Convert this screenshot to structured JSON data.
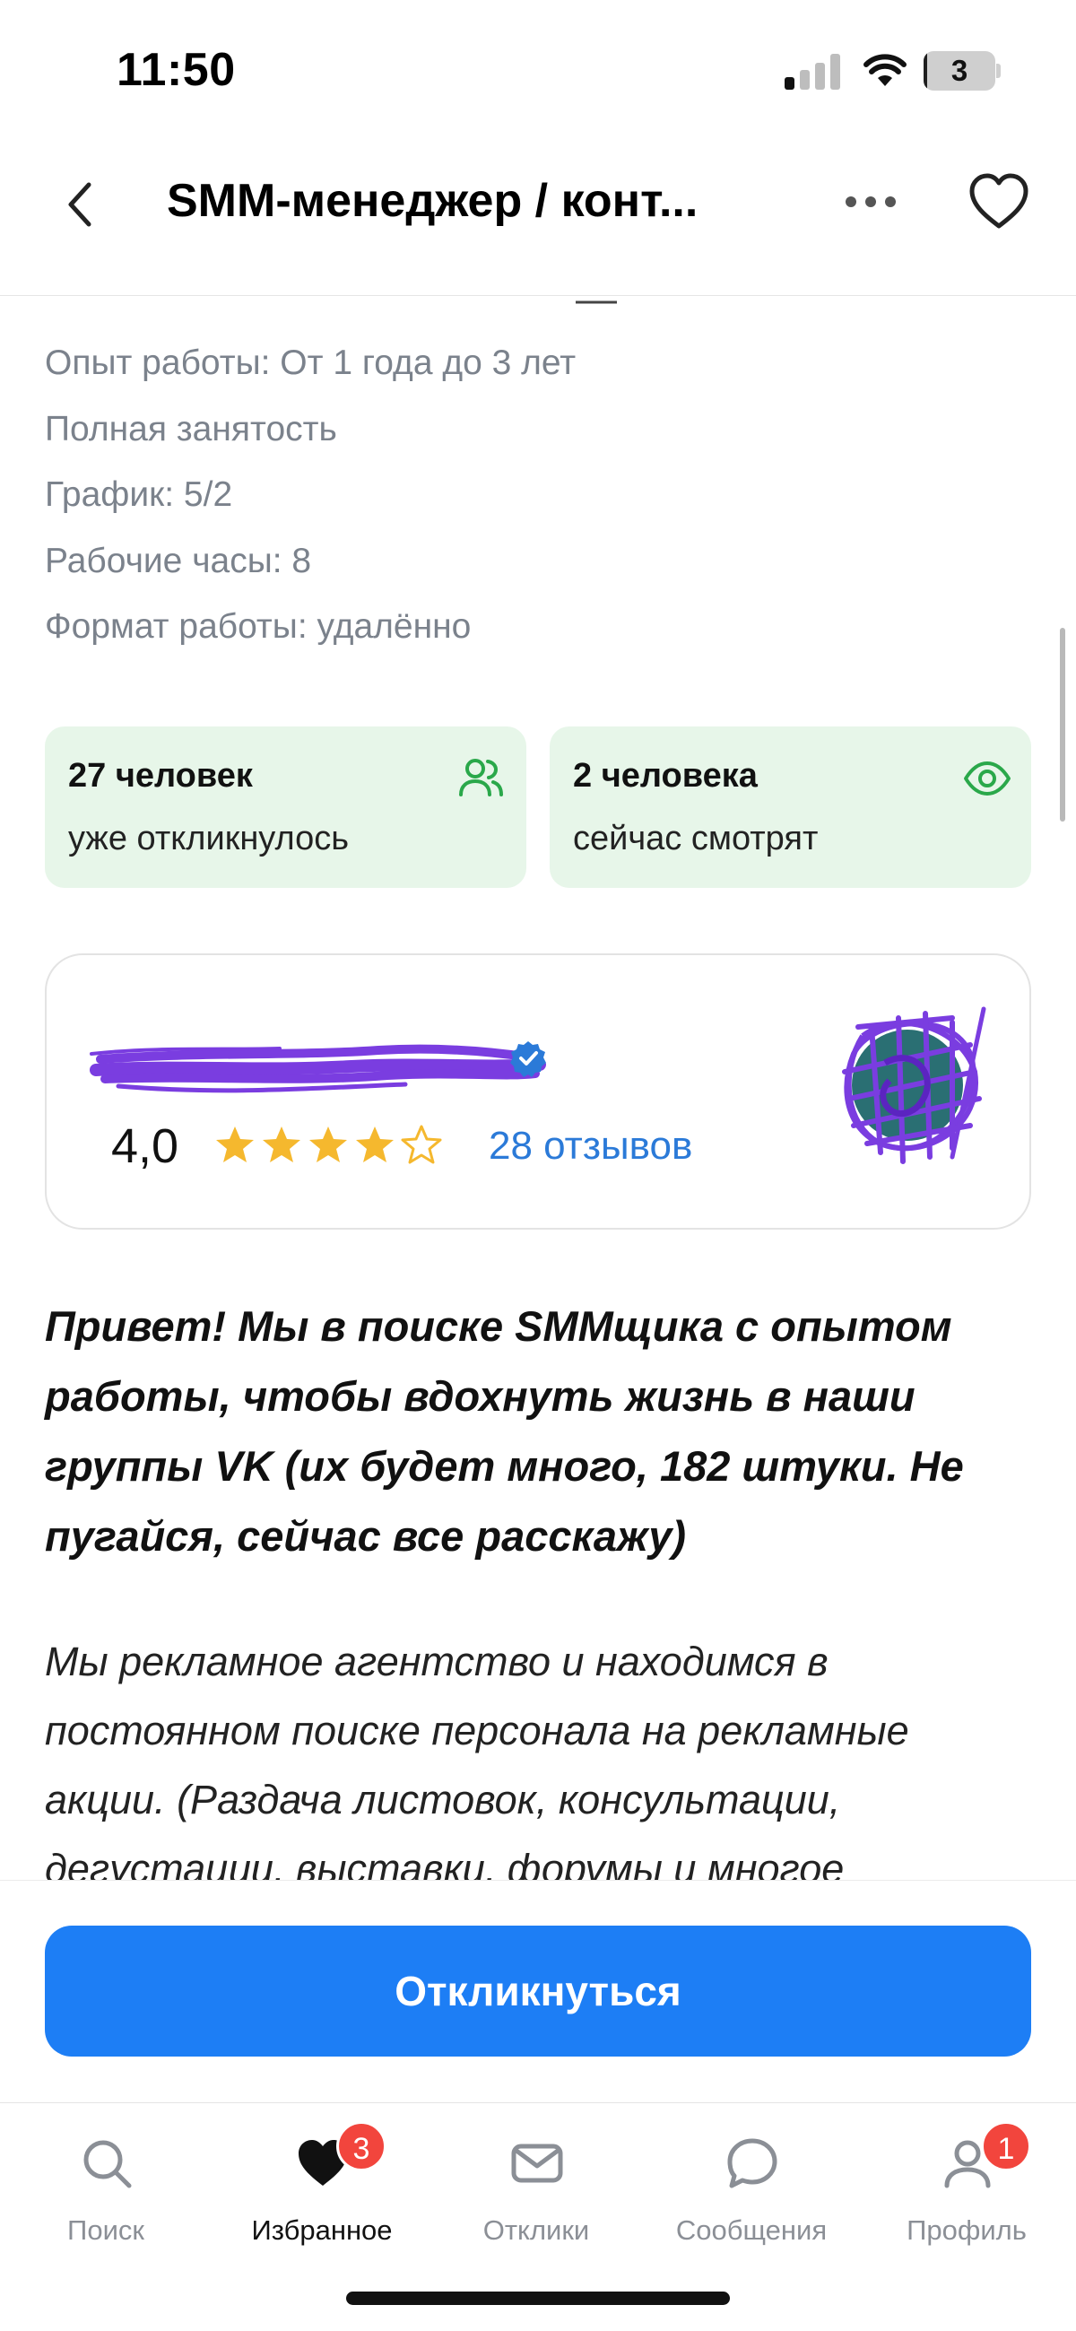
{
  "status_bar": {
    "time": "11:50",
    "battery_level": "3",
    "battery_percent": 3
  },
  "nav": {
    "title": "SMM-менеджер / конт..."
  },
  "details": [
    "Опыт работы: От 1 года до 3 лет",
    "Полная занятость",
    "График: 5/2",
    "Рабочие часы: 8",
    "Формат работы: удалённо"
  ],
  "stats": [
    {
      "title": "27 человек",
      "subtitle": "уже откликнулось",
      "icon": "users-icon"
    },
    {
      "title": "2 человека",
      "subtitle": "сейчас смотрят",
      "icon": "eye-icon"
    }
  ],
  "employer": {
    "rating": "4,0",
    "rating_value": 4,
    "rating_max": 5,
    "reviews": "28 отзывов",
    "verified_icon": "verified-badge-icon"
  },
  "description": {
    "intro": "Привет! Мы в поиске SMMщика с опытом работы, чтобы вдохнуть жизнь в наши группы VK (их будет много, 182 штуки. Не пугайся, сейчас все расскажу)",
    "body": "Мы рекламное агентство и находимся в постоянном поиске персонала на рекламные акции. (Раздача листовок, консультации, дегустации, выставки, форумы и многое"
  },
  "apply_button": "Откликнуться",
  "tabs": [
    {
      "label": "Поиск",
      "icon": "search-icon",
      "badge": ""
    },
    {
      "label": "Избранное",
      "icon": "heart-icon",
      "badge": "3"
    },
    {
      "label": "Отклики",
      "icon": "mail-icon",
      "badge": ""
    },
    {
      "label": "Сообщения",
      "icon": "chat-icon",
      "badge": ""
    },
    {
      "label": "Профиль",
      "icon": "profile-icon",
      "badge": "1"
    }
  ],
  "colors": {
    "accent": "#1d7ef5",
    "stat_card_bg": "#e7f6e9",
    "stat_icon": "#2aa84a",
    "star": "#f5b82e",
    "link": "#2b7ad8",
    "badge": "#f2453d",
    "redaction": "#7a3de0"
  }
}
